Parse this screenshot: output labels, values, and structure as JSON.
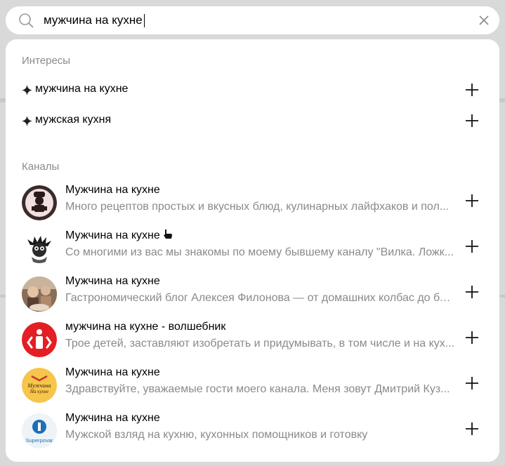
{
  "search": {
    "value": "мужчина на кухне"
  },
  "interests": {
    "title": "Интересы",
    "items": [
      {
        "label": "мужчина на кухне"
      },
      {
        "label": "мужская кухня"
      }
    ]
  },
  "channels": {
    "title": "Каналы",
    "items": [
      {
        "name": "Мужчина на кухне",
        "description": "Много рецептов простых и вкусных блюд, кулинарных лайфхаков и пол..."
      },
      {
        "name": "Мужчина на кухне",
        "description": "Со многими из вас мы знакомы по моему бывшему каналу \"Вилка. Ложк..."
      },
      {
        "name": "Мужчина на кухне",
        "description": "Гастрономический блог Алексея Филонова — от домашних колбас до бл..."
      },
      {
        "name": "мужчина на кухне - волшебник",
        "description": "Трое детей, заставляют изобретать и придумывать, в том числе и на кух..."
      },
      {
        "name": "Мужчина на кухне",
        "description": "Здравствуйте, уважаемые гости моего канала. Меня зовут Дмитрий Куз..."
      },
      {
        "name": "Мужчина на кухне",
        "description": "Мужской взляд на кухню, кухонных помощников и готовку"
      }
    ]
  },
  "avatar_logos": {
    "logo5": "Мужчина На кухне",
    "logo6": "Superpovar"
  },
  "colors": {
    "muted": "#8a8a8a",
    "red": "#e31e24",
    "yellow": "#f6c54a"
  }
}
